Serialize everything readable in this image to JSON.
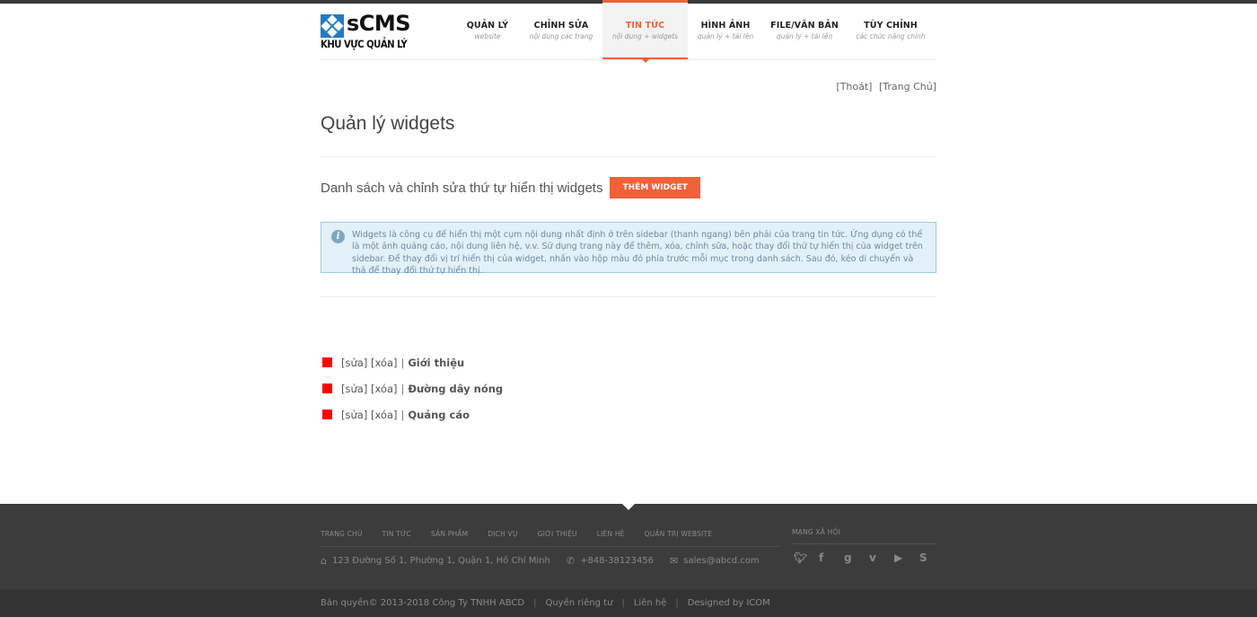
{
  "logo": {
    "brand": "sCMS",
    "subtitle": "KHU VỰC QUẢN LÝ"
  },
  "nav": [
    {
      "title": "QUẢN LÝ",
      "sub": "website",
      "active": false
    },
    {
      "title": "CHỈNH SỬA",
      "sub": "nội dung các trang",
      "active": false
    },
    {
      "title": "TIN TỨC",
      "sub": "nội dung + widgets",
      "active": true
    },
    {
      "title": "HÌNH ẢNH",
      "sub": "quản lý + tải lên",
      "active": false
    },
    {
      "title": "FILE/VĂN BẢN",
      "sub": "quản lý + tải lên",
      "active": false
    },
    {
      "title": "TÙY CHỈNH",
      "sub": "các chức năng chính",
      "active": false
    }
  ],
  "top_links": {
    "logout": "[Thoát]",
    "home": "[Trang Chủ]"
  },
  "page": {
    "title": "Quản lý widgets",
    "section_title": "Danh sách và chỉnh sửa thứ tự hiển thị widgets",
    "add_button": "THÊM WIDGET",
    "info": "Widgets là công cụ để hiển thị một cụm nội dung nhất định ở trên sidebar (thanh ngang) bên phải của trang tin tức. Ứng dụng có thể là một ảnh quảng cáo, nội dung liên hệ, v.v. Sử dụng trang này để thêm, xóa, chỉnh sửa, hoặc thay đổi thứ tự hiển thị của widget trên sidebar. Để thay đổi vị trí hiển thị của widget, nhấn vào hộp màu đỏ phía trước mỗi mục trong danh sách. Sau đó, kéo di chuyển và thả để thay đổi thứ tự hiển thị."
  },
  "widgets": [
    {
      "edit": "[sửa]",
      "delete": "[xóa]",
      "sep": "|",
      "name": "Giới thiệu"
    },
    {
      "edit": "[sửa]",
      "delete": "[xóa]",
      "sep": "|",
      "name": "Đường dây nóng"
    },
    {
      "edit": "[sửa]",
      "delete": "[xóa]",
      "sep": "|",
      "name": "Quảng cáo"
    }
  ],
  "footer": {
    "nav": [
      "TRANG CHỦ",
      "TIN TỨC",
      "SẢN PHẨM",
      "DỊCH VỤ",
      "GIỚI THIỆU",
      "LIÊN HỆ",
      "QUẢN TRỊ WEBSITE"
    ],
    "address": "123 Đường Số 1, Phường 1, Quận 1, Hồ Chí Minh",
    "phone": "+848-38123456",
    "email": "sales@abcd.com",
    "social_title": "MẠNG XÃ HỘI",
    "social_icons": [
      "twitter-icon",
      "facebook-icon",
      "google-plus-icon",
      "vimeo-icon",
      "youtube-icon",
      "skype-icon"
    ],
    "copyright": "Bản quyền© 2013-2018 Công Ty TNHH ABCD",
    "privacy": "Quyền riêng tư",
    "contact": "Liên hệ",
    "designed": "Designed by ICOM"
  },
  "colors": {
    "accent": "#f0613a",
    "logo_blue": "#1f7cc2",
    "handle_red": "#ff0000",
    "footer_bg": "#3c3c3c"
  }
}
